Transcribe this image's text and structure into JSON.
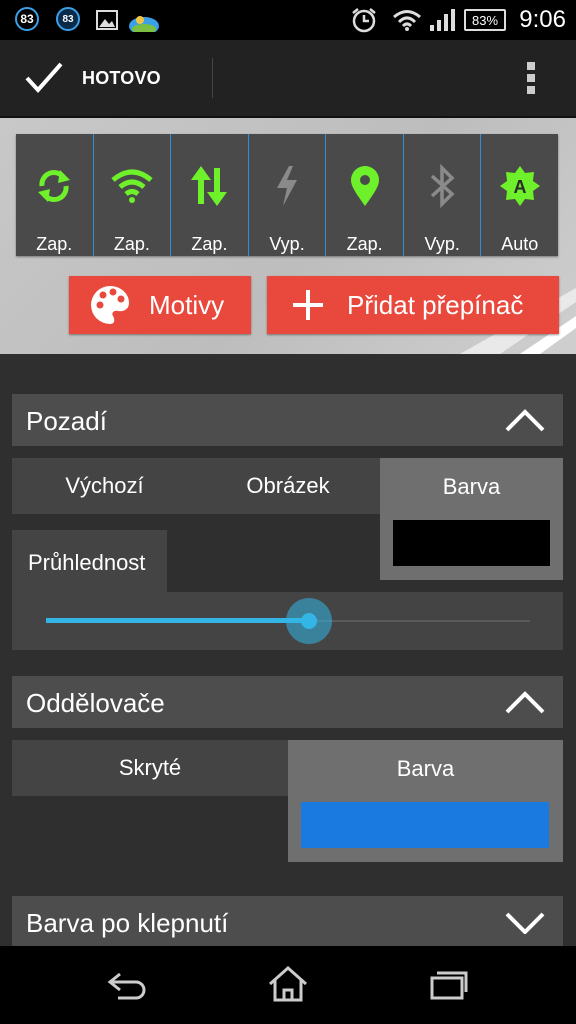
{
  "status_bar": {
    "badge1": "83",
    "badge2": "83",
    "battery": "83%",
    "time": "9:06",
    "icons": [
      "notification-83-icon",
      "notification-83-icon",
      "image-icon",
      "weather-icon",
      "alarm-icon",
      "wifi-icon",
      "signal-icon",
      "battery-icon"
    ]
  },
  "action_bar": {
    "done_label": "HOTOVO",
    "icons": [
      "checkmark-icon",
      "overflow-menu-icon"
    ]
  },
  "preview": {
    "toggles": [
      {
        "icon": "sync-icon",
        "label": "Zap.",
        "color": "#6ef02a"
      },
      {
        "icon": "wifi-icon",
        "label": "Zap.",
        "color": "#6ef02a"
      },
      {
        "icon": "data-transfer-icon",
        "label": "Zap.",
        "color": "#6ef02a"
      },
      {
        "icon": "flash-icon",
        "label": "Vyp.",
        "color": "#8a8a8a"
      },
      {
        "icon": "location-icon",
        "label": "Zap.",
        "color": "#6ef02a"
      },
      {
        "icon": "bluetooth-icon",
        "label": "Vyp.",
        "color": "#8a8a8a"
      },
      {
        "icon": "auto-brightness-icon",
        "label": "Auto",
        "color": "#6ef02a"
      }
    ],
    "themes_button": "Motivy",
    "add_toggle_button": "Přidat přepínač",
    "accent": "#e8493c"
  },
  "background_section": {
    "title": "Pozadí",
    "options": [
      "Výchozí",
      "Obrázek",
      "Barva"
    ],
    "selected": "Barva",
    "color_swatch": "#000000",
    "transparency_label": "Průhlednost",
    "transparency_level": 0.52,
    "slider_color": "#33b5e5"
  },
  "dividers_section": {
    "title": "Oddělovače",
    "options": [
      "Skryté",
      "Barva"
    ],
    "selected": "Barva",
    "color_swatch": "#1a7ae0"
  },
  "tap_color_section": {
    "title": "Barva po klepnutí"
  },
  "nav_bar": {
    "icons": [
      "back-icon",
      "home-icon",
      "recents-icon"
    ]
  }
}
